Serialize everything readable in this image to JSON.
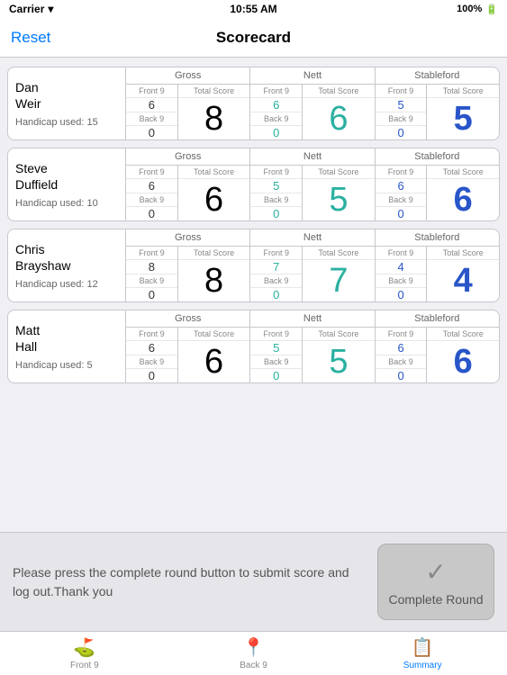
{
  "statusBar": {
    "carrier": "Carrier",
    "time": "10:55 AM",
    "battery": "100%"
  },
  "navBar": {
    "title": "Scorecard",
    "resetLabel": "Reset"
  },
  "players": [
    {
      "id": "player-1",
      "firstName": "Dan",
      "lastName": "Weir",
      "handicap": "Handicap used: 15",
      "gross": {
        "front9": "6",
        "back9": "0",
        "total": "8"
      },
      "nett": {
        "front9": "6",
        "back9": "0",
        "total": "6"
      },
      "stableford": {
        "front9": "5",
        "back9": "0",
        "total": "5"
      }
    },
    {
      "id": "player-2",
      "firstName": "Steve",
      "lastName": "Duffield",
      "handicap": "Handicap used: 10",
      "gross": {
        "front9": "6",
        "back9": "0",
        "total": "6"
      },
      "nett": {
        "front9": "5",
        "back9": "0",
        "total": "5"
      },
      "stableford": {
        "front9": "6",
        "back9": "0",
        "total": "6"
      }
    },
    {
      "id": "player-3",
      "firstName": "Chris",
      "lastName": "Brayshaw",
      "handicap": "Handicap used: 12",
      "gross": {
        "front9": "8",
        "back9": "0",
        "total": "8"
      },
      "nett": {
        "front9": "7",
        "back9": "0",
        "total": "7"
      },
      "stableford": {
        "front9": "4",
        "back9": "0",
        "total": "4"
      }
    },
    {
      "id": "player-4",
      "firstName": "Matt",
      "lastName": "Hall",
      "handicap": "Handicap used: 5",
      "gross": {
        "front9": "6",
        "back9": "0",
        "total": "6"
      },
      "nett": {
        "front9": "5",
        "back9": "0",
        "total": "5"
      },
      "stableford": {
        "front9": "6",
        "back9": "0",
        "total": "6"
      }
    }
  ],
  "labels": {
    "gross": "Gross",
    "nett": "Nett",
    "stableford": "Stableford",
    "front9": "Front 9",
    "back9": "Back 9",
    "totalScore": "Total Score"
  },
  "bottomMessage": "Please press the complete round button to submit score and log out.Thank you",
  "completeRound": "Complete Round",
  "tabs": [
    {
      "id": "front9",
      "label": "Front 9",
      "icon": "⛳",
      "active": false
    },
    {
      "id": "back9",
      "label": "Back 9",
      "icon": "📍",
      "active": false
    },
    {
      "id": "summary",
      "label": "Summary",
      "icon": "📋",
      "active": true
    }
  ]
}
